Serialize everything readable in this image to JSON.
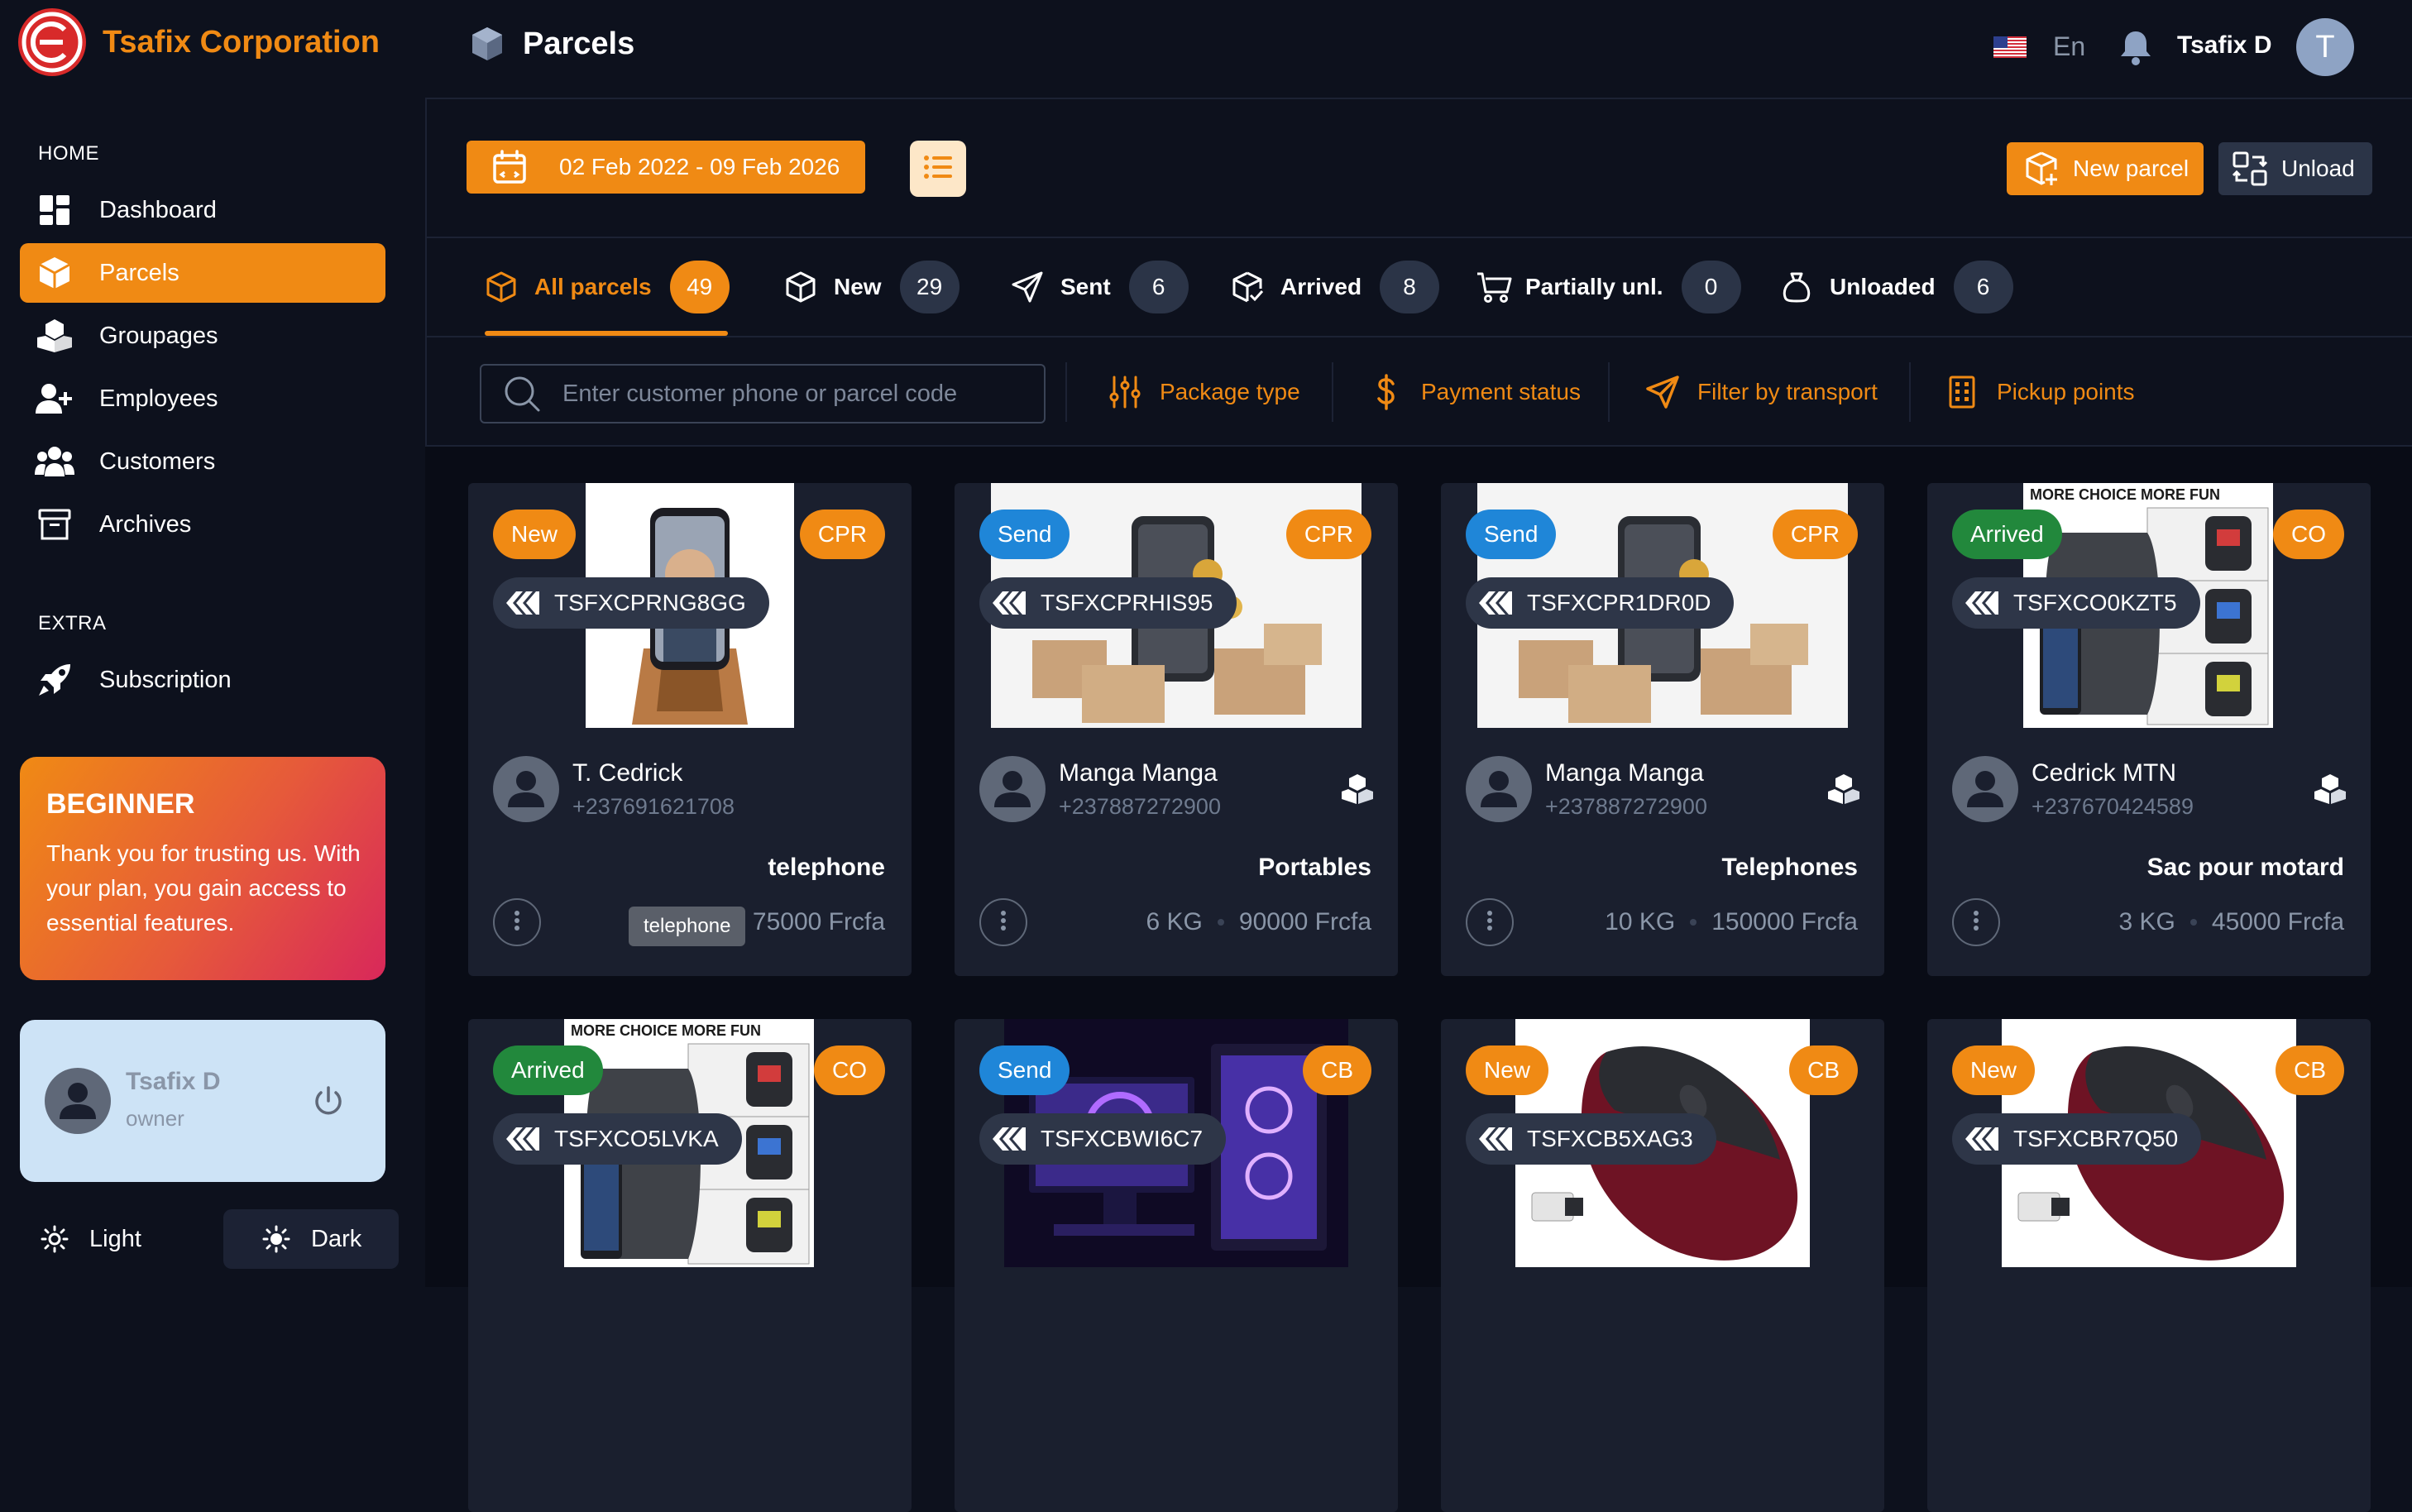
{
  "brand": {
    "name": "Tsafix Corporation"
  },
  "sidebar": {
    "home_heading": "HOME",
    "extra_heading": "EXTRA",
    "items": [
      {
        "label": "Dashboard",
        "icon": "dashboard-icon"
      },
      {
        "label": "Parcels",
        "icon": "cube-icon",
        "active": true
      },
      {
        "label": "Groupages",
        "icon": "boxes-icon"
      },
      {
        "label": "Employees",
        "icon": "user-add-icon"
      },
      {
        "label": "Customers",
        "icon": "users-icon"
      },
      {
        "label": "Archives",
        "icon": "archive-icon"
      }
    ],
    "extra_items": [
      {
        "label": "Subscription",
        "icon": "rocket-icon"
      }
    ],
    "promo": {
      "title": "BEGINNER",
      "text": "Thank you for trusting us. With your plan, you gain access to essential features."
    },
    "user": {
      "name": "Tsafix D",
      "role": "owner"
    },
    "theme": {
      "light": "Light",
      "dark": "Dark"
    }
  },
  "header": {
    "title": "Parcels",
    "language": "En",
    "user_name": "Tsafix D",
    "avatar_initial": "T"
  },
  "toolbar": {
    "date_range": "02 Feb 2022 - 09 Feb 2026",
    "new_parcel": "New parcel",
    "unload": "Unload"
  },
  "tabs": [
    {
      "label": "All parcels",
      "count": "49",
      "icon": "cube-icon",
      "active": true
    },
    {
      "label": "New",
      "count": "29",
      "icon": "box-icon"
    },
    {
      "label": "Sent",
      "count": "6",
      "icon": "send-icon"
    },
    {
      "label": "Arrived",
      "count": "8",
      "icon": "box-check-icon"
    },
    {
      "label": "Partially unl.",
      "count": "0",
      "icon": "cart-icon"
    },
    {
      "label": "Unloaded",
      "count": "6",
      "icon": "bag-icon"
    }
  ],
  "filters": {
    "search_placeholder": "Enter customer phone or parcel code",
    "package_type": "Package type",
    "payment_status": "Payment status",
    "transport": "Filter by transport",
    "pickup": "Pickup points"
  },
  "colors": {
    "accent": "#f08a14",
    "send": "#1f86d8",
    "arrived": "#22883c",
    "background": "#0d111d",
    "card": "#1a1f2e"
  },
  "parcels": [
    {
      "status": "New",
      "category": "CPR",
      "code": "TSFXCPRNG8GG",
      "customer": "T. Cedrick",
      "phone": "+237691621708",
      "name": "telephone",
      "weight": "",
      "price": "75000 Frcfa",
      "tooltip": "telephone",
      "image": "phone-stand"
    },
    {
      "status": "Send",
      "category": "CPR",
      "code": "TSFXCPRHIS95",
      "customer": "Manga Manga",
      "phone": "+237887272900",
      "name": "Portables",
      "weight": "6 KG",
      "price": "90000 Frcfa",
      "image": "phone-boxes"
    },
    {
      "status": "Send",
      "category": "CPR",
      "code": "TSFXCPR1DR0D",
      "customer": "Manga Manga",
      "phone": "+237887272900",
      "name": "Telephones",
      "weight": "10 KG",
      "price": "150000 Frcfa",
      "image": "phone-boxes"
    },
    {
      "status": "Arrived",
      "category": "CO",
      "code": "TSFXCO0KZT5",
      "customer": "Cedrick MTN",
      "phone": "+237670424589",
      "name": "Sac pour motard",
      "weight": "3 KG",
      "price": "45000 Frcfa",
      "image": "backpack-led"
    },
    {
      "status": "Arrived",
      "category": "CO",
      "code": "TSFXCO5LVKA",
      "image": "backpack-led"
    },
    {
      "status": "Send",
      "category": "CB",
      "code": "TSFXCBWI6C7",
      "image": "gaming-pc"
    },
    {
      "status": "New",
      "category": "CB",
      "code": "TSFXCB5XAG3",
      "image": "mouse"
    },
    {
      "status": "New",
      "category": "CB",
      "code": "TSFXCBR7Q50",
      "image": "mouse"
    }
  ],
  "image_text": {
    "banner": "MORE CHOICE MORE FUN"
  }
}
